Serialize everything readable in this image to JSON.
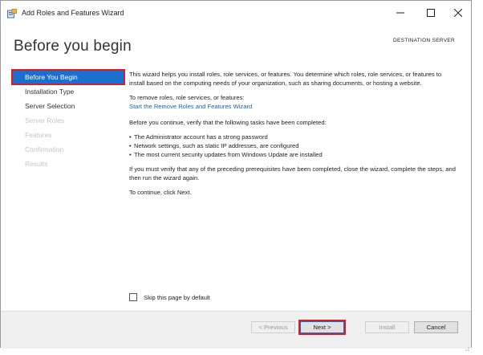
{
  "window": {
    "title": "Add Roles and Features Wizard",
    "controls": {
      "minimize": "—",
      "maximize": "☐",
      "close": "✕"
    }
  },
  "header": {
    "page_title": "Before you begin",
    "destination_label": "DESTINATION SERVER"
  },
  "nav": {
    "items": [
      {
        "label": "Before You Begin",
        "state": "selected"
      },
      {
        "label": "Installation Type",
        "state": "enabled"
      },
      {
        "label": "Server Selection",
        "state": "enabled"
      },
      {
        "label": "Server Roles",
        "state": "disabled"
      },
      {
        "label": "Features",
        "state": "disabled"
      },
      {
        "label": "Confirmation",
        "state": "disabled"
      },
      {
        "label": "Results",
        "state": "disabled"
      }
    ]
  },
  "content": {
    "intro": "This wizard helps you install roles, role services, or features. You determine which roles, role services, or features to install based on the computing needs of your organization, such as sharing documents, or hosting a website.",
    "remove_prompt": "To remove roles, role services, or features:",
    "remove_link": "Start the Remove Roles and Features Wizard",
    "verify_intro": "Before you continue, verify that the following tasks have been completed:",
    "bullets": [
      "The Administrator account has a strong password",
      "Network settings, such as static IP addresses, are configured",
      "The most current security updates from Windows Update are installed"
    ],
    "prerequisites_note": "If you must verify that any of the preceding prerequisites have been completed, close the wizard, complete the steps, and then run the wizard again.",
    "continue_note": "To continue, click Next."
  },
  "skip_checkbox": {
    "label": "Skip this page by default",
    "checked": false
  },
  "footer": {
    "previous": "< Previous",
    "next": "Next >",
    "install": "Install",
    "cancel": "Cancel"
  },
  "colors": {
    "selection": "#1a6fcf",
    "highlight_annotation": "#d61f26",
    "link": "#1865a8"
  }
}
